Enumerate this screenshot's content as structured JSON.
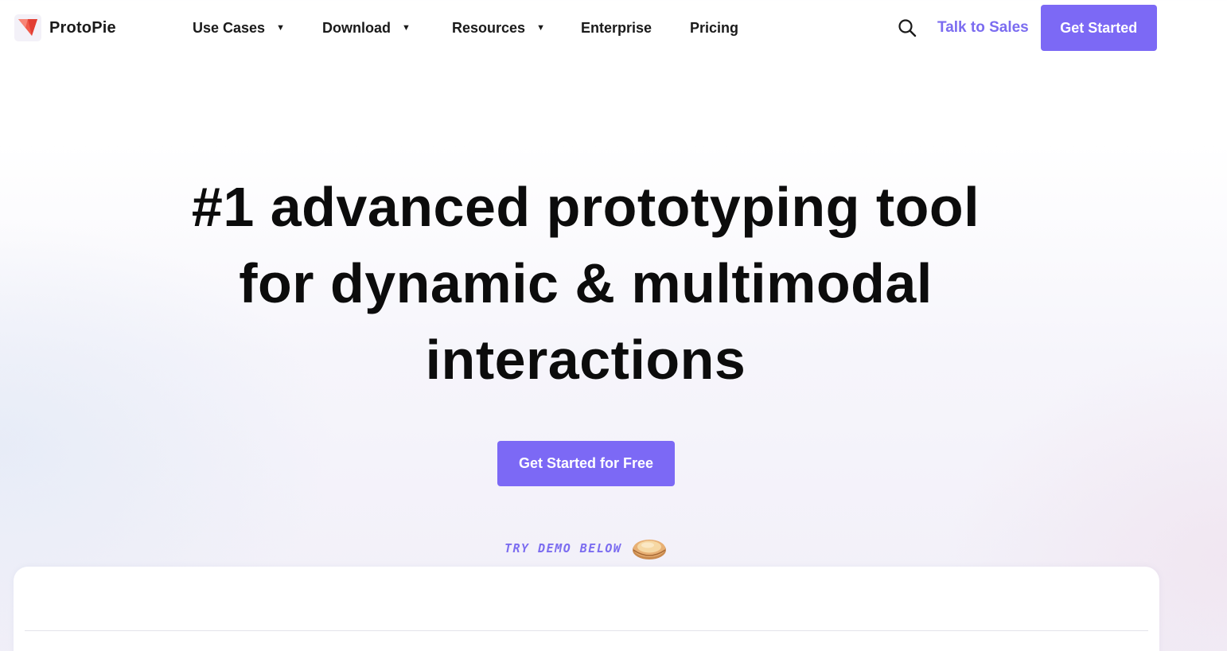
{
  "brand": {
    "name": "ProtoPie",
    "accent": "#7c69f5",
    "logo_color": "#f15a4a"
  },
  "nav": {
    "items": [
      {
        "label": "Use Cases",
        "dropdown": true
      },
      {
        "label": "Download",
        "dropdown": true
      },
      {
        "label": "Resources",
        "dropdown": true
      },
      {
        "label": "Enterprise",
        "dropdown": false
      },
      {
        "label": "Pricing",
        "dropdown": false
      }
    ],
    "search_icon": "search-icon",
    "talk_to_sales": "Talk to Sales",
    "cta": "Get Started"
  },
  "hero": {
    "title_line1": "#1 advanced prototyping tool",
    "title_line2": "for dynamic & multimodal",
    "title_line3": "interactions",
    "cta": "Get Started for Free",
    "demo_note": "TRY DEMO BELOW",
    "demo_icon": "pie-icon"
  }
}
